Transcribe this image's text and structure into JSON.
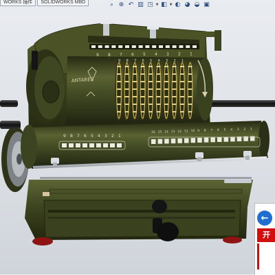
{
  "app": {
    "tabs": [
      {
        "label": "WORKS 插件"
      },
      {
        "label": "SOLIDWORKS MBD"
      }
    ]
  },
  "heads_up_toolbar": {
    "buttons": [
      {
        "icon": "zoom-to-fit-icon",
        "glyph": "⌕"
      },
      {
        "icon": "zoom-to-area-icon",
        "glyph": "⊕"
      },
      {
        "icon": "previous-view-icon",
        "glyph": "↶"
      },
      {
        "icon": "section-view-icon",
        "glyph": "▥"
      },
      {
        "icon": "view-orientation-icon",
        "glyph": "◳"
      },
      {
        "icon": "display-style-icon",
        "glyph": "◧"
      },
      {
        "icon": "hide-show-items-icon",
        "glyph": "◐"
      },
      {
        "icon": "edit-appearance-icon",
        "glyph": "◕"
      },
      {
        "icon": "apply-scene-icon",
        "glyph": "◒"
      },
      {
        "icon": "view-settings-icon",
        "glyph": "▣"
      }
    ]
  },
  "model": {
    "brand_text": "ANTARES",
    "top_digits": [
      "9",
      "8",
      "7",
      "6",
      "5",
      "4",
      "3",
      "2",
      "1"
    ],
    "mid_digits": [
      "9",
      "8",
      "7",
      "6",
      "5",
      "4",
      "3",
      "2",
      "1"
    ],
    "carriage_left_digits": [
      "9",
      "8",
      "7",
      "6",
      "5",
      "4",
      "3",
      "2",
      "1"
    ],
    "carriage_right_digits": [
      "16",
      "15",
      "14",
      "13",
      "12",
      "11",
      "10",
      "9",
      "8",
      "7",
      "6",
      "5",
      "4",
      "3",
      "2",
      "1"
    ],
    "colors": {
      "body": "#3d4420",
      "body_light": "#58602f",
      "body_dark": "#23270f",
      "wheel_gold": "#d7b24a",
      "chrome": "#c6ccd2",
      "shaft": "#18191b",
      "foot": "#8e1414"
    }
  },
  "task_pane": {
    "back_icon": "arrow-left-icon",
    "back_glyph": "←",
    "logo_text": "开"
  }
}
